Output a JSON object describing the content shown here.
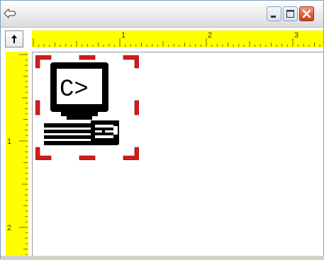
{
  "window": {
    "title_icon": "move-arrow-icon",
    "buttons": [
      "minimize-icon",
      "maximize-icon",
      "close-icon"
    ]
  },
  "rulers": {
    "corner_icon": "up-arrow-icon",
    "color": "#ffff00",
    "horizontal_labels": [
      "1",
      "2",
      "3"
    ],
    "vertical_labels": [
      "1",
      "2"
    ]
  },
  "canvas": {
    "object": {
      "icon": "computer-dos-prompt-icon",
      "screen_text": "C>",
      "selected": true,
      "handle_color": "#cc0000"
    }
  }
}
